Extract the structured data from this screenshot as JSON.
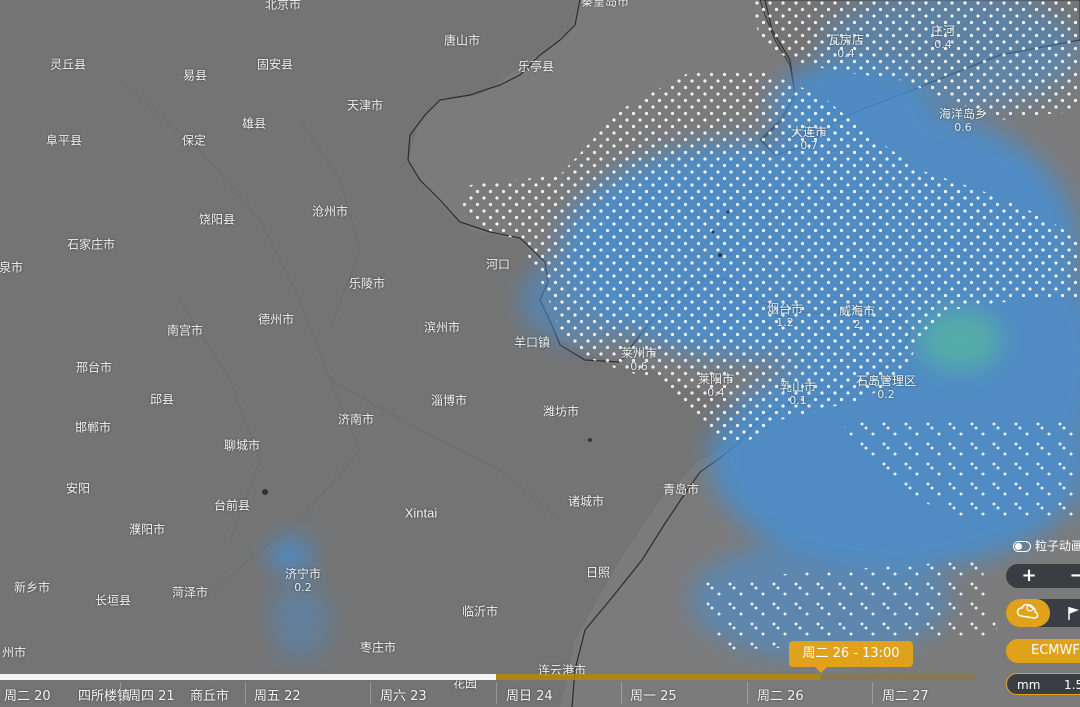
{
  "map": {
    "cities": [
      {
        "name": "北京市",
        "value": ""
      },
      {
        "name": "秦皇岛市",
        "value": ""
      },
      {
        "name": "唐山市",
        "value": ""
      },
      {
        "name": "乐亭县",
        "value": ""
      },
      {
        "name": "灵丘县",
        "value": ""
      },
      {
        "name": "固安县",
        "value": ""
      },
      {
        "name": "易县",
        "value": ""
      },
      {
        "name": "天津市",
        "value": ""
      },
      {
        "name": "雄县",
        "value": ""
      },
      {
        "name": "阜平县",
        "value": ""
      },
      {
        "name": "保定",
        "value": ""
      },
      {
        "name": "沧州市",
        "value": ""
      },
      {
        "name": "饶阳县",
        "value": ""
      },
      {
        "name": "石家庄市",
        "value": ""
      },
      {
        "name": "泉市",
        "value": ""
      },
      {
        "name": "河口",
        "value": ""
      },
      {
        "name": "乐陵市",
        "value": ""
      },
      {
        "name": "南宫市",
        "value": ""
      },
      {
        "name": "德州市",
        "value": ""
      },
      {
        "name": "滨州市",
        "value": ""
      },
      {
        "name": "羊口镇",
        "value": ""
      },
      {
        "name": "邢台市",
        "value": ""
      },
      {
        "name": "邱县",
        "value": ""
      },
      {
        "name": "淄博市",
        "value": ""
      },
      {
        "name": "潍坊市",
        "value": ""
      },
      {
        "name": "济南市",
        "value": ""
      },
      {
        "name": "邯郸市",
        "value": ""
      },
      {
        "name": "聊城市",
        "value": ""
      },
      {
        "name": "安阳",
        "value": ""
      },
      {
        "name": "台前县",
        "value": ""
      },
      {
        "name": "濮阳市",
        "value": ""
      },
      {
        "name": "Xintai",
        "value": ""
      },
      {
        "name": "诸城市",
        "value": ""
      },
      {
        "name": "青岛市",
        "value": ""
      },
      {
        "name": "济宁市",
        "value": "0.2"
      },
      {
        "name": "新乡市",
        "value": ""
      },
      {
        "name": "长垣县",
        "value": ""
      },
      {
        "name": "菏泽市",
        "value": ""
      },
      {
        "name": "日照",
        "value": ""
      },
      {
        "name": "临沂市",
        "value": ""
      },
      {
        "name": "枣庄市",
        "value": ""
      },
      {
        "name": "州市",
        "value": ""
      },
      {
        "name": "连云港市",
        "value": ""
      },
      {
        "name": "花园",
        "value": ""
      },
      {
        "name": "瓦房店",
        "value": "0.4"
      },
      {
        "name": "庄河",
        "value": "0.4"
      },
      {
        "name": "海洋岛乡",
        "value": "0.6"
      },
      {
        "name": "大连市",
        "value": "0.7"
      },
      {
        "name": "烟台市",
        "value": "1.2"
      },
      {
        "name": "威海市",
        "value": "2"
      },
      {
        "name": "莱州市",
        "value": "0.6"
      },
      {
        "name": "莱阳市",
        "value": "0.4"
      },
      {
        "name": "乳山市",
        "value": "0.1"
      },
      {
        "name": "石岛管理区",
        "value": "0.2"
      }
    ]
  },
  "timeline": {
    "days": [
      "周二 20",
      "四所楼镇",
      "周四 21",
      "商丘市",
      "周五 22",
      "周六 23",
      "周日 24",
      "周一 25",
      "周二 26",
      "周二 27"
    ],
    "current_time": "周二 26 - 13:00",
    "progress_played": 0.508,
    "progress_marker": 0.84
  },
  "controls": {
    "particle_label": "粒子动画",
    "zoom_in": "+",
    "zoom_out": "−",
    "layer_rain_icon": "rain-cloud-icon",
    "layer_flag_icon": "flag-icon",
    "model": "ECMWF",
    "unit": "mm",
    "unit_value": "1.5"
  },
  "colors": {
    "land": "#747474",
    "sea": "#7b7b7b",
    "precip": "#4a8fd0",
    "accent": "#e1a21b"
  }
}
